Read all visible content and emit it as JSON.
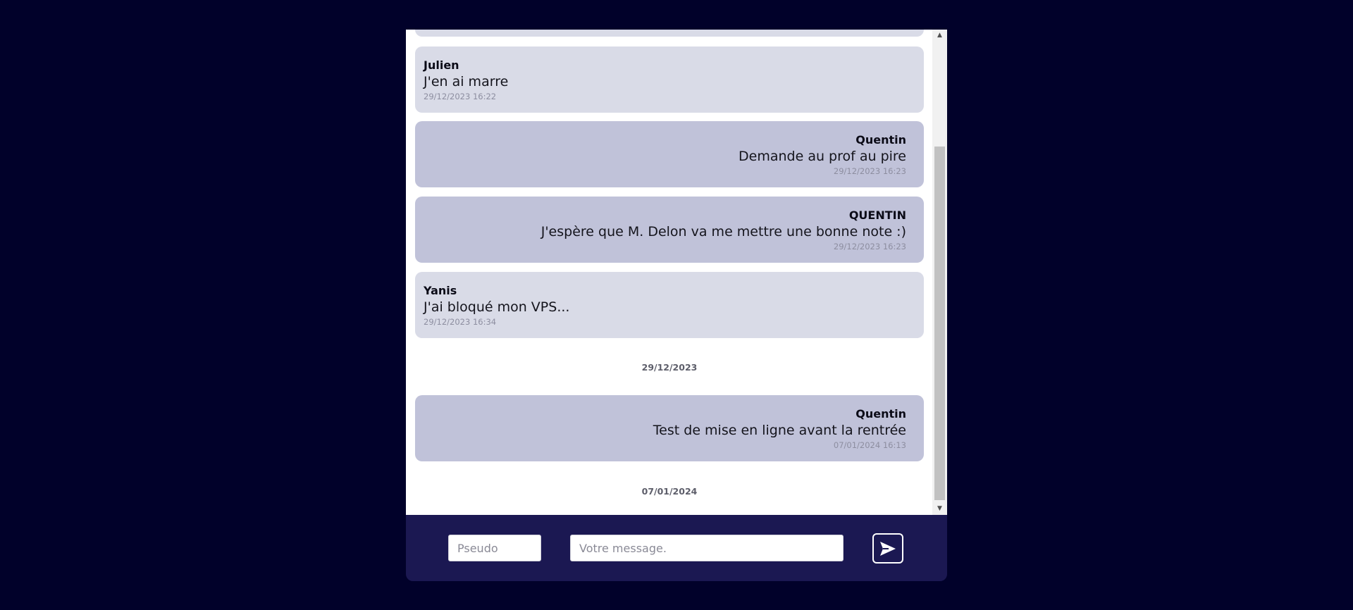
{
  "messages": [
    {
      "author": "Julien",
      "text": "J'en ai marre",
      "time": "29/12/2023 16:22",
      "side": "other"
    },
    {
      "author": "Quentin",
      "text": "Demande au prof au pire",
      "time": "29/12/2023 16:23",
      "side": "self"
    },
    {
      "author": "QUENTIN",
      "text": "J'espère que M. Delon va me mettre une bonne note :)",
      "time": "29/12/2023 16:23",
      "side": "self"
    },
    {
      "author": "Yanis",
      "text": "J'ai bloqué mon VPS...",
      "time": "29/12/2023 16:34",
      "side": "other"
    },
    {
      "author": "Quentin",
      "text": "Test de mise en ligne avant la rentrée",
      "time": "07/01/2024 16:13",
      "side": "self"
    }
  ],
  "day_separators": [
    "29/12/2023",
    "07/01/2024"
  ],
  "compose": {
    "pseudo_placeholder": "Pseudo",
    "message_placeholder": "Votre message."
  },
  "icons": {
    "send": "send-icon",
    "scroll_up": "triangle-up",
    "scroll_down": "triangle-down"
  },
  "colors": {
    "page_background": "#01012a",
    "compose_background": "#1b1852",
    "bubble_other": "#d9dbe7",
    "bubble_self": "#c0c2d9"
  }
}
